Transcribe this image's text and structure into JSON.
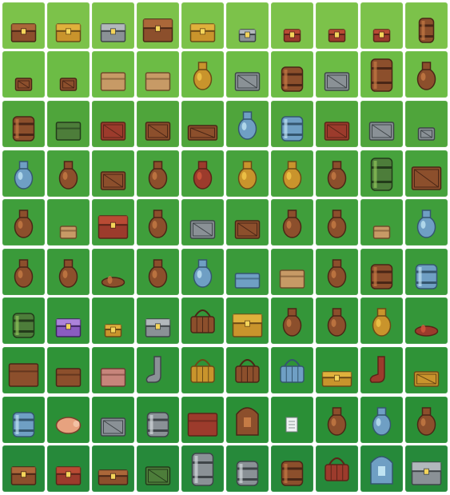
{
  "sheet": {
    "title": "",
    "background_color": "#ffffff",
    "row_colors": [
      "#7cc24a",
      "#6cbc45",
      "#4fa53b",
      "#46a23c",
      "#3f9e3b",
      "#3a9a3a",
      "#349639",
      "#2f9337",
      "#2a8f36",
      "#26893a"
    ],
    "rows": [
      {
        "items": [
          "treasure-chest-wood",
          "chest-open-gold",
          "chest-iron-banded",
          "chest-large-banded",
          "chest-gold-lock",
          "chest-small-grey",
          "chest-small-red",
          "chest-jewel-red",
          "chest-white-red",
          "barrel-small"
        ]
      },
      {
        "items": [
          "crate-small-a",
          "crate-small-b",
          "cardboard-box-open",
          "cardboard-box",
          "sack-flour",
          "steel-crate",
          "barrel-round-large",
          "metal-cage-box",
          "milk-can",
          "ornate-urn"
        ]
      },
      {
        "items": [
          "barrel-wood",
          "briefcase-green",
          "crate-red-carved",
          "crate-dark-frame",
          "crate-long",
          "porcelain-vase",
          "water-barrel-blue",
          "crate-red",
          "cage-crate",
          "safe-small"
        ]
      },
      {
        "items": [
          "vase-blue",
          "pot-skull",
          "crate-wood-plank",
          "bag-leather",
          "clay-pot-red",
          "sack-green",
          "gourd",
          "jar-clay",
          "barrel-tall-green",
          "crate-wood-large"
        ]
      },
      {
        "items": [
          "vase-clay",
          "box-cardboard-small",
          "dragon-chest",
          "pot-brown",
          "metal-panel-box",
          "crate-stack",
          "pot-face",
          "leather-pouch",
          "box-wood-small",
          "jar-blue-label"
        ]
      },
      {
        "items": [
          "pot-small",
          "chalice-pot",
          "bowl-clay",
          "vase-tall",
          "jar-round-teal",
          "box-shallow-teal",
          "gift-box",
          "pot-dark",
          "canister-striped",
          "barrel-blue-band"
        ]
      },
      {
        "items": [
          "barrel-green-slime",
          "chest-purple",
          "chest-gold-small",
          "chest-jail-grey",
          "basket-wicker",
          "chest-gold-ornate",
          "vase-bronze",
          "pot-swirl",
          "sack-money",
          "bowl-dark-red"
        ]
      },
      {
        "items": [
          "dresser-wood",
          "shopping-bag",
          "box-pink",
          "sock-grey",
          "basket-yellow",
          "picnic-basket",
          "basket-blue",
          "chest-long-yellow",
          "slipper-red",
          "crate-flat-yellow"
        ]
      },
      {
        "items": [
          "bucket-blue",
          "piggy-bank",
          "safe-steel",
          "trash-can",
          "wardrobe-red",
          "cabinet-arched",
          "note-card",
          "lantern-dark",
          "flask-glass",
          "jar-skull"
        ]
      },
      {
        "items": [
          "suitcase-brown",
          "suitcase-red",
          "trunk-long",
          "crate-green-slat",
          "locker-grey",
          "trash-bin-arch",
          "barrel-dark",
          "basket-red-drawer",
          "tombstone-blue",
          "chest-silver-ornate"
        ]
      }
    ]
  }
}
